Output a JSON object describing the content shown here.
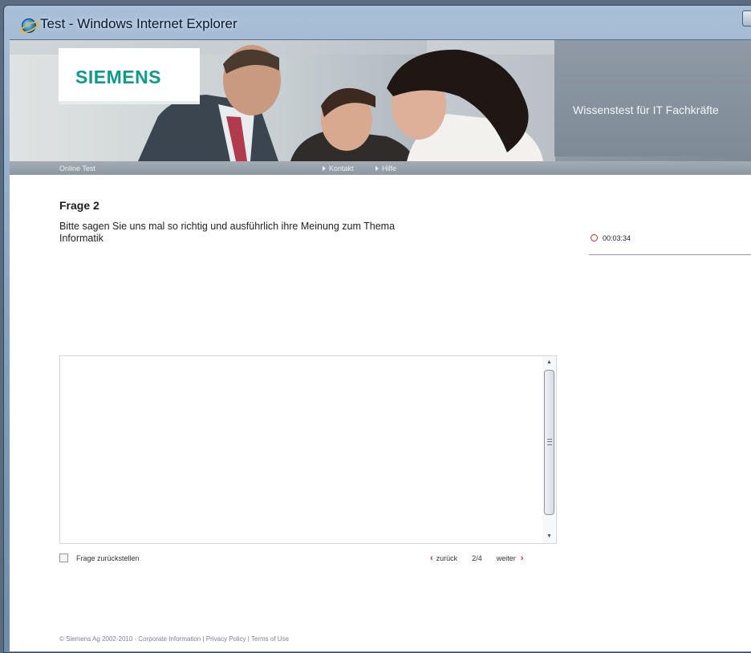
{
  "window": {
    "title": "Test - Windows Internet Explorer"
  },
  "header": {
    "logo_text": "SIEMENS",
    "subtitle": "Wissenstest für IT Fachkräfte"
  },
  "nav": {
    "label": "Online Test",
    "links": [
      "Kontakt",
      "Hilfe"
    ]
  },
  "question": {
    "heading": "Frage 2",
    "text": "Bitte sagen Sie uns mal so richtig und ausführlich ihre Meinung zum Thema Informatik"
  },
  "timer": {
    "value": "00:03:34"
  },
  "answer": {
    "value": ""
  },
  "controls": {
    "defer_label": "Frage zurückstellen",
    "back_label": "zurück",
    "page_indicator": "2/4",
    "next_label": "weiter"
  },
  "footer": {
    "text": "© Siemens Ag 2002-2010 - Corporate Information | Privacy Policy | Terms of Use"
  },
  "colors": {
    "brand": "#0d9a8b",
    "accent_red": "#c9302c"
  }
}
